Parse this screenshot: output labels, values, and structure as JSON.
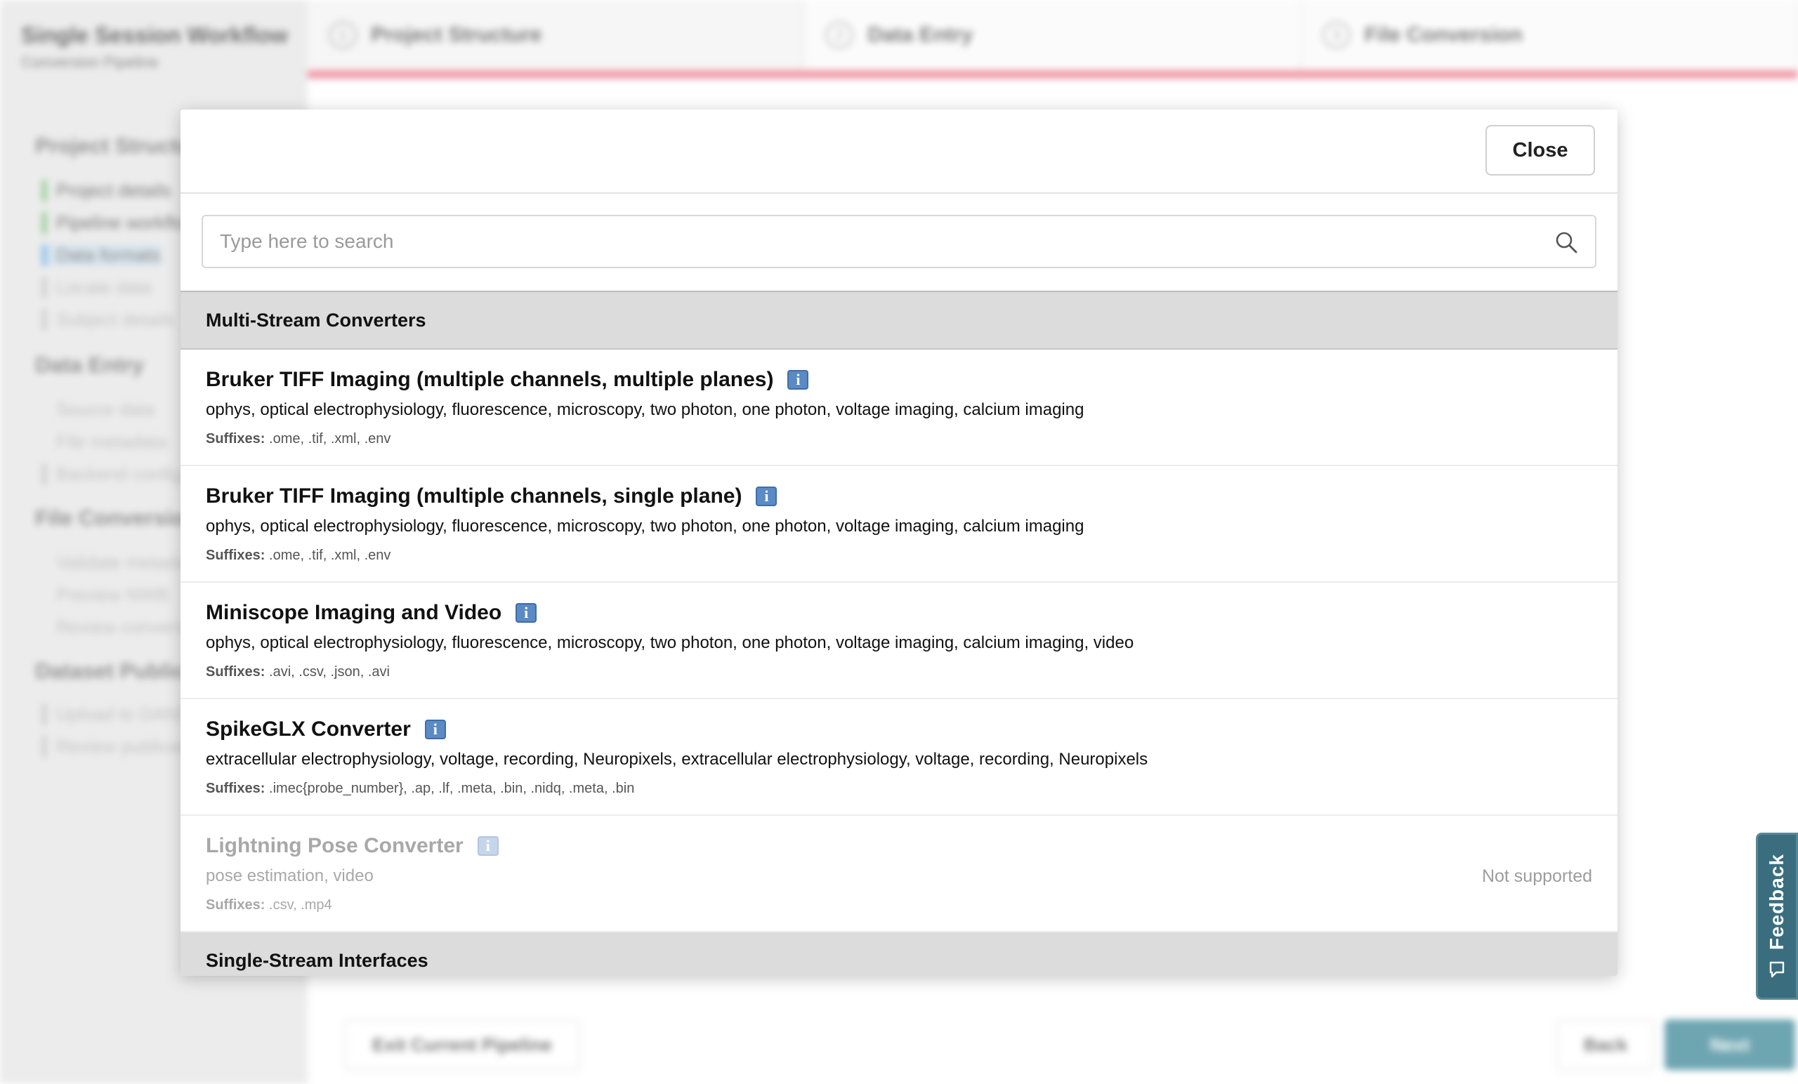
{
  "sidebar": {
    "title": "Single Session Workflow",
    "subtitle": "Conversion Pipeline",
    "sections": [
      {
        "label": "Project Structure",
        "items": [
          {
            "label": "Project details",
            "state": "done"
          },
          {
            "label": "Pipeline workflow",
            "state": "done"
          },
          {
            "label": "Data formats",
            "state": "active"
          },
          {
            "label": "Locate data",
            "state": "pending"
          },
          {
            "label": "Subject details",
            "state": "pending"
          }
        ]
      },
      {
        "label": "Data Entry",
        "items": [
          {
            "label": "Source data",
            "state": "plain"
          },
          {
            "label": "File metadata",
            "state": "plain"
          },
          {
            "label": "Backend configuration",
            "state": "pending"
          }
        ]
      },
      {
        "label": "File Conversion",
        "items": [
          {
            "label": "Validate metadata",
            "state": "plain"
          },
          {
            "label": "Preview NWB",
            "state": "plain"
          },
          {
            "label": "Review conversion",
            "state": "plain"
          }
        ]
      },
      {
        "label": "Dataset Publication",
        "items": [
          {
            "label": "Upload to DANDI",
            "state": "pending"
          },
          {
            "label": "Review publication",
            "state": "pending"
          }
        ]
      }
    ]
  },
  "stepper": [
    {
      "num": "1",
      "label": "Project Structure"
    },
    {
      "num": "2",
      "label": "Data Entry"
    },
    {
      "num": "3",
      "label": "File Conversion"
    }
  ],
  "footer": {
    "exit": "Exit Current Pipeline",
    "back": "Back",
    "next": "Next"
  },
  "modal": {
    "close_label": "Close",
    "search_placeholder": "Type here to search",
    "groups": [
      {
        "header": "Multi-Stream Converters",
        "items": [
          {
            "name": "Bruker TIFF Imaging (multiple channels, multiple planes)",
            "keywords": "ophys, optical electrophysiology, fluorescence, microscopy, two photon, one photon, voltage imaging, calcium imaging",
            "suffix_label": "Suffixes:",
            "suffixes": ".ome, .tif, .xml, .env"
          },
          {
            "name": "Bruker TIFF Imaging (multiple channels, single plane)",
            "keywords": "ophys, optical electrophysiology, fluorescence, microscopy, two photon, one photon, voltage imaging, calcium imaging",
            "suffix_label": "Suffixes:",
            "suffixes": ".ome, .tif, .xml, .env"
          },
          {
            "name": "Miniscope Imaging and Video",
            "keywords": "ophys, optical electrophysiology, fluorescence, microscopy, two photon, one photon, voltage imaging, calcium imaging, video",
            "suffix_label": "Suffixes:",
            "suffixes": ".avi, .csv, .json, .avi"
          },
          {
            "name": "SpikeGLX Converter",
            "keywords": "extracellular electrophysiology, voltage, recording, Neuropixels, extracellular electrophysiology, voltage, recording, Neuropixels",
            "suffix_label": "Suffixes:",
            "suffixes": ".imec{probe_number}, .ap, .lf, .meta, .bin, .nidq, .meta, .bin"
          },
          {
            "name": "Lightning Pose Converter",
            "keywords": "pose estimation, video",
            "suffix_label": "Suffixes:",
            "suffixes": ".csv, .mp4",
            "status": "Not supported"
          }
        ]
      },
      {
        "header": "Single-Stream Interfaces",
        "items": []
      }
    ]
  },
  "feedback": {
    "label": "Feedback"
  },
  "colors": {
    "accent": "#e96e83",
    "primary": "#2f7f90",
    "info_icon": "#5b8ac4",
    "feedback": "#3a6e7f"
  },
  "icons": {
    "search": "search-icon",
    "info": "info-icon",
    "feedback": "feedback-icon"
  }
}
